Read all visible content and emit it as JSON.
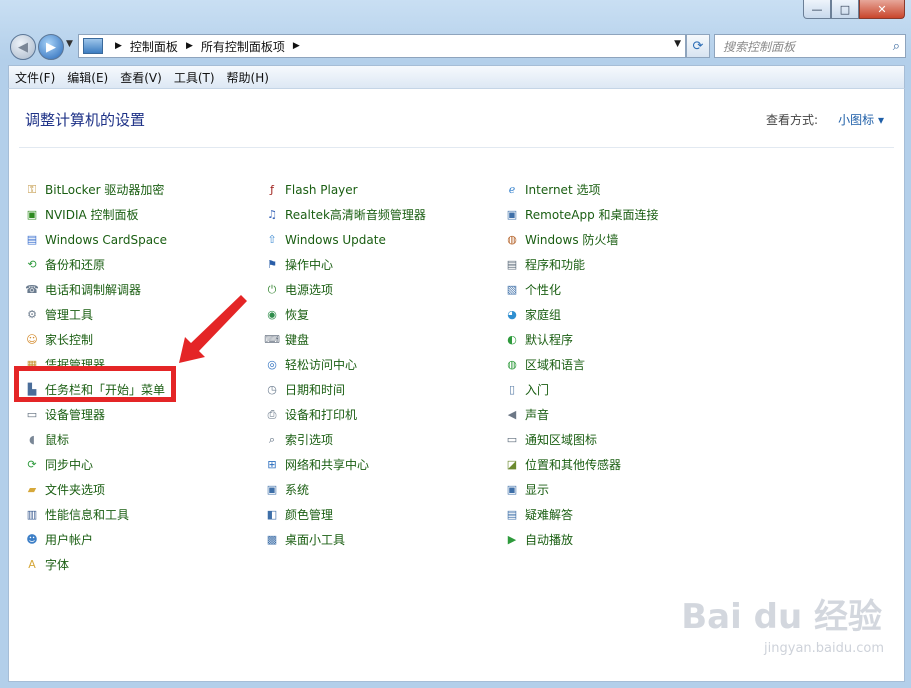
{
  "titlebar": {
    "min": "—",
    "max": "□",
    "close": "✕"
  },
  "address": {
    "crumbs": [
      "控制面板",
      "所有控制面板项"
    ]
  },
  "search": {
    "placeholder": "搜索控制面板"
  },
  "menu": [
    "文件(F)",
    "编辑(E)",
    "查看(V)",
    "工具(T)",
    "帮助(H)"
  ],
  "heading": "调整计算机的设置",
  "view": {
    "label": "查看方式:",
    "value": "小图标 ▾"
  },
  "columns": [
    [
      {
        "label": "BitLocker 驱动器加密",
        "icon": "key-icon",
        "glyph": "⚿",
        "color": "#b9882a"
      },
      {
        "label": "NVIDIA 控制面板",
        "icon": "nvidia-icon",
        "glyph": "▣",
        "color": "#2d8a1e"
      },
      {
        "label": "Windows CardSpace",
        "icon": "cardspace-icon",
        "glyph": "▤",
        "color": "#3a6fcf"
      },
      {
        "label": "备份和还原",
        "icon": "backup-icon",
        "glyph": "⟲",
        "color": "#2e9a3c"
      },
      {
        "label": "电话和调制解调器",
        "icon": "phone-icon",
        "glyph": "☎",
        "color": "#6a7b8e"
      },
      {
        "label": "管理工具",
        "icon": "admin-tools-icon",
        "glyph": "⚙",
        "color": "#6f7e8f"
      },
      {
        "label": "家长控制",
        "icon": "parental-icon",
        "glyph": "☺",
        "color": "#d48a2b"
      },
      {
        "label": "凭据管理器",
        "icon": "credential-icon",
        "glyph": "▦",
        "color": "#c6912c"
      },
      {
        "label": "任务栏和「开始」菜单",
        "icon": "taskbar-icon",
        "glyph": "▙",
        "color": "#4a6d99"
      },
      {
        "label": "设备管理器",
        "icon": "device-manager-icon",
        "glyph": "▭",
        "color": "#5c6b7a"
      },
      {
        "label": "鼠标",
        "icon": "mouse-icon",
        "glyph": "◖",
        "color": "#7a8796"
      },
      {
        "label": "同步中心",
        "icon": "sync-icon",
        "glyph": "⟳",
        "color": "#2e9a3c"
      },
      {
        "label": "文件夹选项",
        "icon": "folder-icon",
        "glyph": "▰",
        "color": "#d6a83a"
      },
      {
        "label": "性能信息和工具",
        "icon": "performance-icon",
        "glyph": "▥",
        "color": "#3a5b8f"
      },
      {
        "label": "用户帐户",
        "icon": "users-icon",
        "glyph": "☻",
        "color": "#3d7fc7"
      },
      {
        "label": "字体",
        "icon": "font-icon",
        "glyph": "A",
        "color": "#d6a83a"
      }
    ],
    [
      {
        "label": "Flash Player",
        "icon": "flash-icon",
        "glyph": "ƒ",
        "color": "#9c1b16"
      },
      {
        "label": "Realtek高清晰音频管理器",
        "icon": "realtek-icon",
        "glyph": "♫",
        "color": "#3b66b8"
      },
      {
        "label": "Windows Update",
        "icon": "windows-update-icon",
        "glyph": "⇧",
        "color": "#3e8bd2"
      },
      {
        "label": "操作中心",
        "icon": "flag-icon",
        "glyph": "⚑",
        "color": "#2a5ea8"
      },
      {
        "label": "电源选项",
        "icon": "power-icon",
        "glyph": "⏻",
        "color": "#3d8a3a"
      },
      {
        "label": "恢复",
        "icon": "recovery-icon",
        "glyph": "◉",
        "color": "#2e8c4a"
      },
      {
        "label": "键盘",
        "icon": "keyboard-icon",
        "glyph": "⌨",
        "color": "#6d7886"
      },
      {
        "label": "轻松访问中心",
        "icon": "ease-of-access-icon",
        "glyph": "◎",
        "color": "#2c6fbf"
      },
      {
        "label": "日期和时间",
        "icon": "clock-icon",
        "glyph": "◷",
        "color": "#6a7b8e"
      },
      {
        "label": "设备和打印机",
        "icon": "printer-icon",
        "glyph": "⎙",
        "color": "#56677a"
      },
      {
        "label": "索引选项",
        "icon": "index-icon",
        "glyph": "⌕",
        "color": "#56677a"
      },
      {
        "label": "网络和共享中心",
        "icon": "network-icon",
        "glyph": "⊞",
        "color": "#2c6fbf"
      },
      {
        "label": "系统",
        "icon": "system-icon",
        "glyph": "▣",
        "color": "#3e6fa8"
      },
      {
        "label": "颜色管理",
        "icon": "color-icon",
        "glyph": "◧",
        "color": "#3e6fa8"
      },
      {
        "label": "桌面小工具",
        "icon": "gadgets-icon",
        "glyph": "▩",
        "color": "#3e6fa8"
      }
    ],
    [
      {
        "label": "Internet 选项",
        "icon": "internet-icon",
        "glyph": "ℯ",
        "color": "#3c86cf"
      },
      {
        "label": "RemoteApp 和桌面连接",
        "icon": "remoteapp-icon",
        "glyph": "▣",
        "color": "#3e6fa8"
      },
      {
        "label": "Windows 防火墙",
        "icon": "firewall-icon",
        "glyph": "◍",
        "color": "#b5632a"
      },
      {
        "label": "程序和功能",
        "icon": "programs-icon",
        "glyph": "▤",
        "color": "#5c6b7a"
      },
      {
        "label": "个性化",
        "icon": "personalize-icon",
        "glyph": "▧",
        "color": "#3e6fa8"
      },
      {
        "label": "家庭组",
        "icon": "homegroup-icon",
        "glyph": "◕",
        "color": "#2f8fd0"
      },
      {
        "label": "默认程序",
        "icon": "default-programs-icon",
        "glyph": "◐",
        "color": "#2e9a3c"
      },
      {
        "label": "区域和语言",
        "icon": "globe-icon",
        "glyph": "◍",
        "color": "#2e9a3c"
      },
      {
        "label": "入门",
        "icon": "getting-started-icon",
        "glyph": "▯",
        "color": "#5c7fa8"
      },
      {
        "label": "声音",
        "icon": "speaker-icon",
        "glyph": "◀",
        "color": "#6d7886"
      },
      {
        "label": "通知区域图标",
        "icon": "notification-icon",
        "glyph": "▭",
        "color": "#5c6b7a"
      },
      {
        "label": "位置和其他传感器",
        "icon": "sensor-icon",
        "glyph": "◪",
        "color": "#6b8a2e"
      },
      {
        "label": "显示",
        "icon": "display-icon",
        "glyph": "▣",
        "color": "#3e6fa8"
      },
      {
        "label": "疑难解答",
        "icon": "troubleshoot-icon",
        "glyph": "▤",
        "color": "#3e6fa8"
      },
      {
        "label": "自动播放",
        "icon": "autoplay-icon",
        "glyph": "▶",
        "color": "#2e9a3c"
      }
    ]
  ],
  "watermark": {
    "logo": "Bai du 经验",
    "url": "jingyan.baidu.com"
  }
}
